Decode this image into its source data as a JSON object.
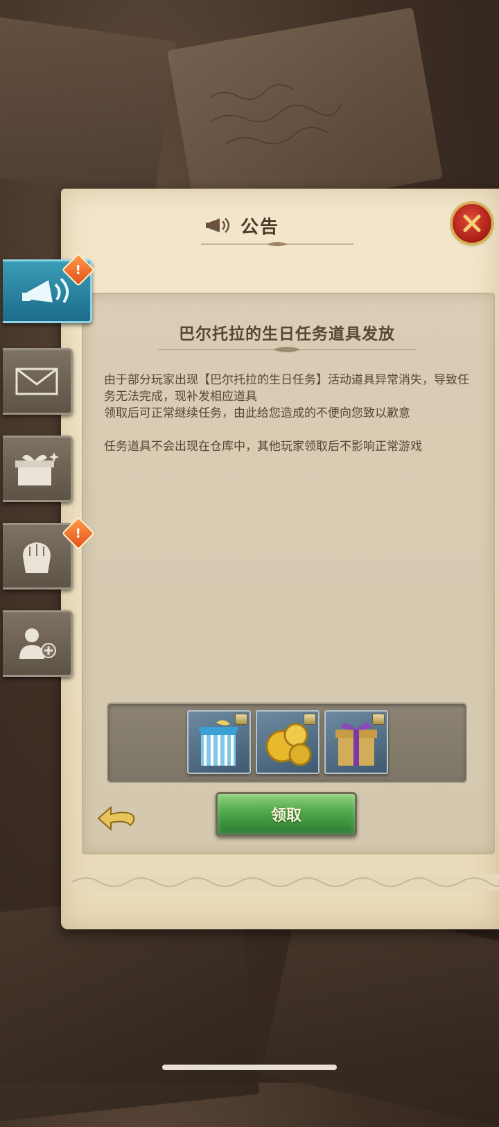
{
  "panel": {
    "title": "公告",
    "close_icon": "close-x-icon"
  },
  "side_tabs": [
    {
      "icon": "megaphone-icon",
      "active": true,
      "alert": "!"
    },
    {
      "icon": "mail-icon",
      "active": false
    },
    {
      "icon": "gift-box-icon",
      "active": false
    },
    {
      "icon": "fist-icon",
      "active": false,
      "alert": "!"
    },
    {
      "icon": "add-friend-icon",
      "active": false
    }
  ],
  "article": {
    "title": "巴尔托拉的生日任务道具发放",
    "paragraph1": "由于部分玩家出现【巴尔托拉的生日任务】活动道具异常消失，导致任务无法完成，现补发相应道具",
    "paragraph2": "领取后可正常继续任务，由此给您造成的不便向您致以歉意",
    "paragraph3": "任务道具不会出现在仓库中，其他玩家领取后不影响正常游戏"
  },
  "rewards": [
    {
      "icon": "striped-gift-box-icon",
      "locked": true
    },
    {
      "icon": "gold-coins-icon",
      "locked": true
    },
    {
      "icon": "purple-ribbon-gift-icon",
      "locked": true
    }
  ],
  "actions": {
    "claim_label": "领取",
    "back_icon": "back-arrow-icon"
  },
  "colors": {
    "parchment": "#f2e7cc",
    "content_bg": "#d9cdb5",
    "text": "#5a4535",
    "active_tab": "#2a88a6",
    "claim_button": "#4da84a",
    "close_button": "#b0241a"
  }
}
